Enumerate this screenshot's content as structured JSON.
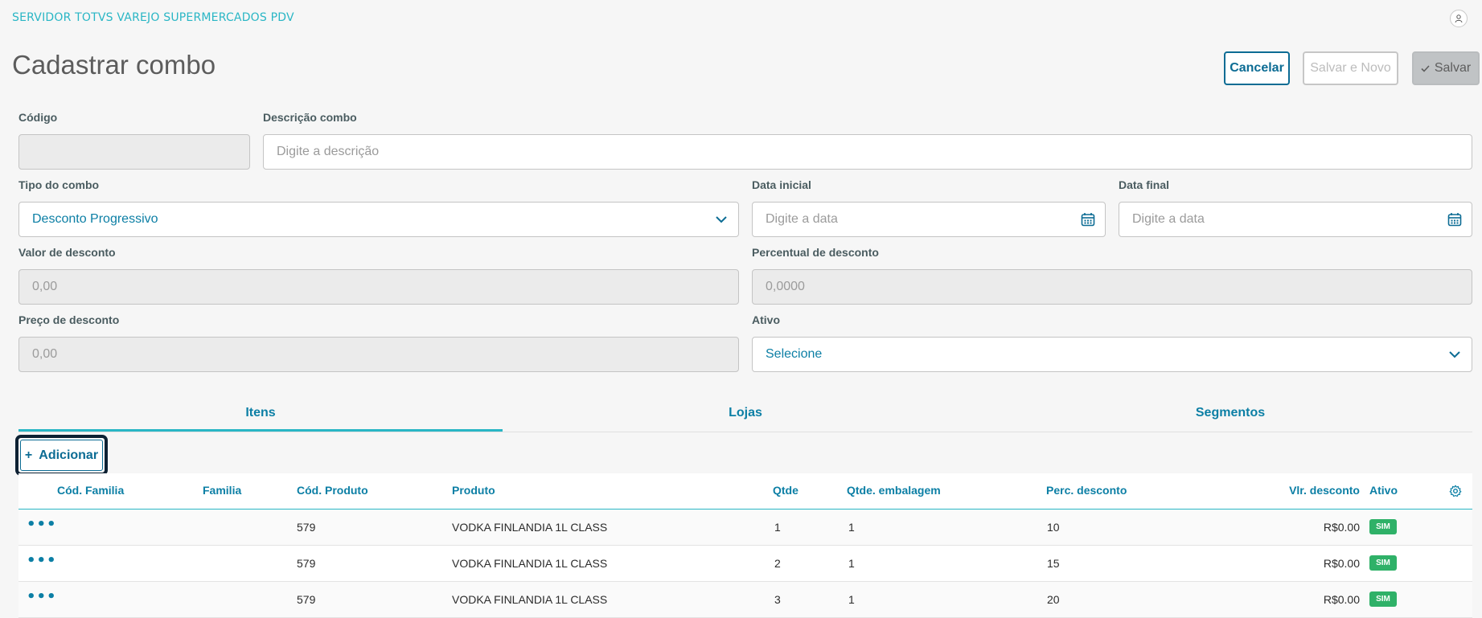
{
  "header": {
    "app_title": "SERVIDOR TOTVS VAREJO SUPERMERCADOS PDV",
    "page_title": "Cadastrar combo"
  },
  "actions": {
    "cancel": "Cancelar",
    "save_new": "Salvar e Novo",
    "save": "Salvar"
  },
  "form": {
    "codigo": {
      "label": "Código",
      "value": ""
    },
    "descricao": {
      "label": "Descrição combo",
      "placeholder": "Digite a descrição"
    },
    "tipo": {
      "label": "Tipo do combo",
      "value": "Desconto Progressivo"
    },
    "data_inicial": {
      "label": "Data inicial",
      "placeholder": "Digite a data"
    },
    "data_final": {
      "label": "Data final",
      "placeholder": "Digite a data"
    },
    "valor_desconto": {
      "label": "Valor de desconto",
      "value": "0,00"
    },
    "percentual_desconto": {
      "label": "Percentual de desconto",
      "value": "0,0000"
    },
    "preco_desconto": {
      "label": "Preço de desconto",
      "value": "0,00"
    },
    "ativo": {
      "label": "Ativo",
      "value": "Selecione"
    }
  },
  "tabs": [
    {
      "label": "Itens",
      "active": true
    },
    {
      "label": "Lojas",
      "active": false
    },
    {
      "label": "Segmentos",
      "active": false
    }
  ],
  "add_button": {
    "label": "Adicionar",
    "icon": "+"
  },
  "table": {
    "columns": [
      "Cód. Familia",
      "Familia",
      "Cód. Produto",
      "Produto",
      "Qtde",
      "Qtde. embalagem",
      "Perc. desconto",
      "Vlr. desconto",
      "Ativo"
    ],
    "rows": [
      {
        "cod_familia": "",
        "familia": "",
        "cod_produto": "579",
        "produto": "VODKA FINLANDIA 1L CLASS",
        "qtde": "1",
        "qtde_embalagem": "1",
        "perc_desconto": "10",
        "vlr_desconto": "R$0.00",
        "ativo": "SIM"
      },
      {
        "cod_familia": "",
        "familia": "",
        "cod_produto": "579",
        "produto": "VODKA FINLANDIA 1L CLASS",
        "qtde": "2",
        "qtde_embalagem": "1",
        "perc_desconto": "15",
        "vlr_desconto": "R$0.00",
        "ativo": "SIM"
      },
      {
        "cod_familia": "",
        "familia": "",
        "cod_produto": "579",
        "produto": "VODKA FINLANDIA 1L CLASS",
        "qtde": "3",
        "qtde_embalagem": "1",
        "perc_desconto": "20",
        "vlr_desconto": "R$0.00",
        "ativo": "SIM"
      }
    ],
    "row_menu": "•••"
  },
  "colors": {
    "accent": "#29b6c5",
    "primary": "#0c6c94",
    "success_badge": "#2fb168"
  },
  "icons": [
    "user-icon",
    "calendar-icon",
    "chevron-down-icon",
    "check-icon",
    "gear-icon",
    "more-icon"
  ]
}
